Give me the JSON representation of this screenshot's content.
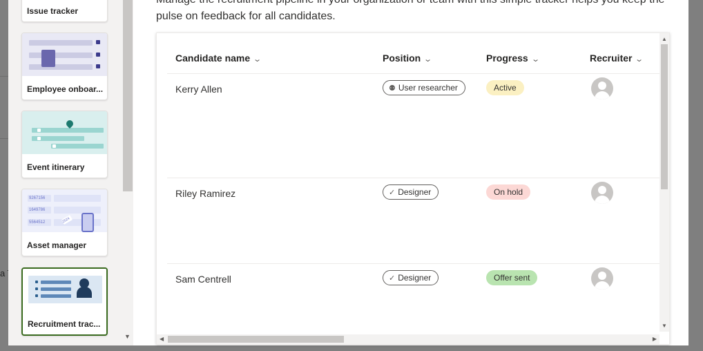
{
  "background": {
    "partial_text": "a T"
  },
  "description": "Manage the recruitment pipeline in your organization or team with this simple tracker helps you keep the pulse on feedback for all candidates.",
  "templates": [
    {
      "label": "Issue tracker"
    },
    {
      "label": "Employee onboar..."
    },
    {
      "label": "Event itinerary"
    },
    {
      "label": "Asset manager",
      "thumb_numbers": [
        "9267156",
        "1649786",
        "5564512"
      ],
      "tag_text": "2524"
    },
    {
      "label": "Recruitment trac...",
      "selected": true
    }
  ],
  "table": {
    "columns": [
      {
        "label": "Candidate name"
      },
      {
        "label": "Position"
      },
      {
        "label": "Progress"
      },
      {
        "label": "Recruiter"
      }
    ],
    "rows": [
      {
        "name": "Kerry Allen",
        "position": "User researcher",
        "position_icon": "person-search-icon",
        "progress": "Active",
        "progress_color": "#fbf0c2"
      },
      {
        "name": "Riley Ramirez",
        "position": "Designer",
        "position_icon": "checkmark-icon",
        "progress": "On hold",
        "progress_color": "#fcd8d5"
      },
      {
        "name": "Sam Centrell",
        "position": "Designer",
        "position_icon": "checkmark-icon",
        "progress": "Offer sent",
        "progress_color": "#b9e4b0"
      }
    ]
  },
  "colors": {
    "selected_border": "#3a6b1f",
    "overlay": "#7f7f7f"
  }
}
